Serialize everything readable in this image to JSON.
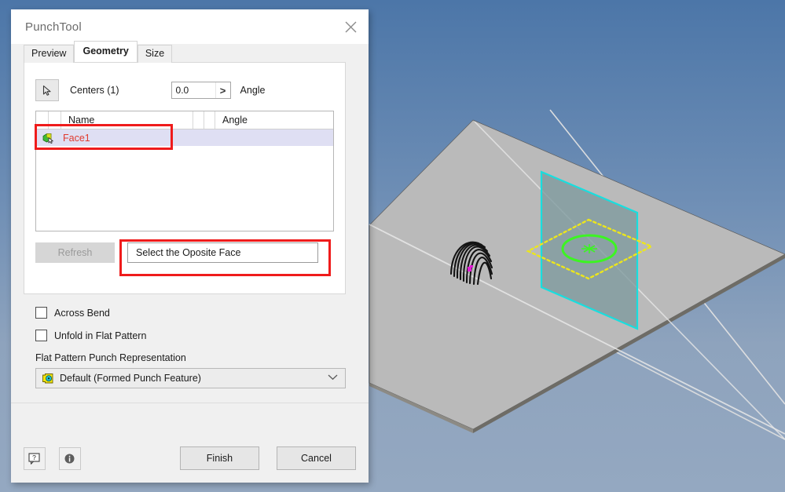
{
  "window": {
    "title": "PunchTool",
    "close_icon": "close-icon"
  },
  "tabs": [
    {
      "label": "Preview",
      "active": false
    },
    {
      "label": "Geometry",
      "active": true
    },
    {
      "label": "Size",
      "active": false
    }
  ],
  "geometry": {
    "select_icon": "cursor-arrow-icon",
    "centers_label": "Centers (1)",
    "angle_value": "0.0",
    "angle_stepper_glyph": ">",
    "angle_label": "Angle",
    "list": {
      "columns": [
        "",
        "",
        "Name",
        "",
        "",
        "Angle"
      ],
      "rows": [
        {
          "icon": "face-select-icon",
          "name": "Face1",
          "angle": ""
        }
      ]
    },
    "refresh_label": "Refresh",
    "note_value": "Select the Oposite Face"
  },
  "options": {
    "across_bend": {
      "label": "Across Bend",
      "checked": false
    },
    "unfold_flat_pattern": {
      "label": "Unfold in Flat Pattern",
      "checked": false
    },
    "flat_pattern_group_label": "Flat Pattern Punch Representation",
    "representation_value": "Default (Formed Punch Feature)",
    "representation_icon": "punch-feature-icon",
    "representation_arrow": "chevron-down-icon"
  },
  "footer": {
    "help_icon": "help-balloon-icon",
    "info_icon": "info-icon",
    "finish_label": "Finish",
    "cancel_label": "Cancel"
  },
  "annotations": [
    {
      "name": "face1-row-highlight",
      "color": "#ef1b1b"
    },
    {
      "name": "note-field-highlight",
      "color": "#ef1b1b"
    }
  ],
  "viewport": {
    "colors": {
      "background_top": "#4c76a8",
      "background_bottom": "#93a7c0",
      "sheet_face": "#b9b9b6",
      "sketch_plane": "#7e9a9b",
      "sketch_plane_edge": "#1fe0e0",
      "sketch_circle": "#3cf522",
      "sketch_boundary": "#e8e82a",
      "axis_line": "#e9e9e9",
      "origin_marker": "#e21ad6",
      "punch_wireframe": "#151515"
    },
    "elements": [
      {
        "name": "sheet-metal-plate"
      },
      {
        "name": "punch-arc-wireframe"
      },
      {
        "name": "origin-marker"
      },
      {
        "name": "sketch-plane"
      },
      {
        "name": "sketch-boundary-diamond"
      },
      {
        "name": "sketch-circle"
      },
      {
        "name": "sketch-center-cross"
      },
      {
        "name": "work-axis-x"
      },
      {
        "name": "work-axis-y"
      }
    ]
  }
}
